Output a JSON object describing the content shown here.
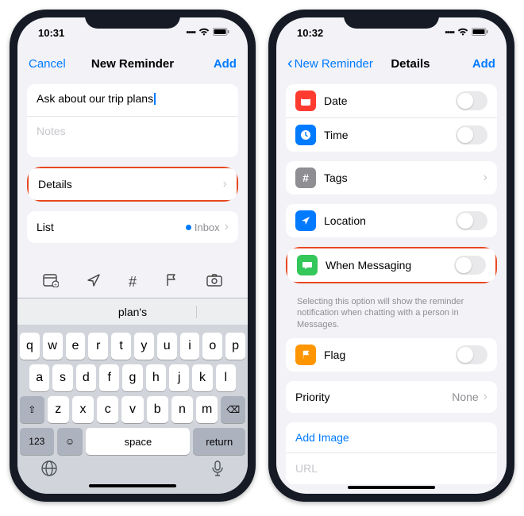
{
  "left": {
    "status_time": "10:31",
    "nav_cancel": "Cancel",
    "nav_title": "New Reminder",
    "nav_add": "Add",
    "title_value": "Ask about our trip plans",
    "notes_placeholder": "Notes",
    "details_label": "Details",
    "list_label": "List",
    "list_value": "Inbox",
    "suggestion": "plan's",
    "row1": [
      "q",
      "w",
      "e",
      "r",
      "t",
      "y",
      "u",
      "i",
      "o",
      "p"
    ],
    "row2": [
      "a",
      "s",
      "d",
      "f",
      "g",
      "h",
      "j",
      "k",
      "l"
    ],
    "row3": [
      "z",
      "x",
      "c",
      "v",
      "b",
      "n",
      "m"
    ],
    "key_123": "123",
    "key_space": "space",
    "key_return": "return"
  },
  "right": {
    "status_time": "10:32",
    "nav_back": "New Reminder",
    "nav_title": "Details",
    "nav_add": "Add",
    "date": "Date",
    "time": "Time",
    "tags": "Tags",
    "location": "Location",
    "when_messaging": "When Messaging",
    "when_messaging_note": "Selecting this option will show the reminder notification when chatting with a person in Messages.",
    "flag": "Flag",
    "priority": "Priority",
    "priority_value": "None",
    "add_image": "Add Image",
    "url": "URL",
    "colors": {
      "date": "#ff3b30",
      "time": "#007aff",
      "tags": "#8e8e93",
      "location": "#007aff",
      "messaging": "#34c759",
      "flag": "#ff9500"
    }
  }
}
